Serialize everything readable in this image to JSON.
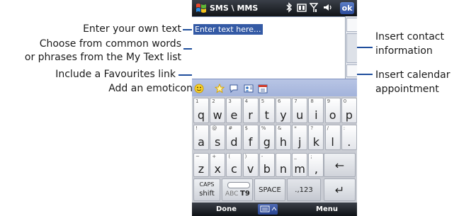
{
  "callouts": {
    "enter_text": "Enter your own text",
    "choose_line1": "Choose from common words",
    "choose_line2": "or phrases from the My Text list",
    "favourites": "Include a Favourites link",
    "emoticon": "Add an emoticon",
    "contact_line1": "Insert contact",
    "contact_line2": "information",
    "calendar_line1": "Insert calendar",
    "calendar_line2": "appointment"
  },
  "phone": {
    "title": "SMS \\ MMS",
    "ok_label": "ok",
    "placeholder": "Enter text here...",
    "softkeys": {
      "left": "Done",
      "right": "Menu"
    },
    "toolbar_icons": [
      "emoticon-icon",
      "favourites-star-icon",
      "my-text-icon",
      "contact-card-icon",
      "calendar-icon"
    ],
    "status_icons": [
      "bluetooth-icon",
      "data-icon",
      "signal-icon",
      "volume-icon"
    ],
    "keyboard": {
      "row1": [
        {
          "sub": "1",
          "main": "q"
        },
        {
          "sub": "2",
          "main": "w"
        },
        {
          "sub": "3",
          "main": "e"
        },
        {
          "sub": "4",
          "main": "r"
        },
        {
          "sub": "5",
          "main": "t"
        },
        {
          "sub": "6",
          "main": "y"
        },
        {
          "sub": "7",
          "main": "u"
        },
        {
          "sub": "8",
          "main": "i"
        },
        {
          "sub": "9",
          "main": "o"
        },
        {
          "sub": "0",
          "main": "p"
        }
      ],
      "row2": [
        {
          "sub": "!",
          "main": "a"
        },
        {
          "sub": "@",
          "main": "s"
        },
        {
          "sub": "#",
          "main": "d"
        },
        {
          "sub": "$",
          "main": "f"
        },
        {
          "sub": "%",
          "main": "g"
        },
        {
          "sub": "&",
          "main": "h"
        },
        {
          "sub": "*",
          "main": "j"
        },
        {
          "sub": "?",
          "main": "k"
        },
        {
          "sub": "/",
          "main": "l"
        },
        {
          "sub": ":",
          "main": "."
        }
      ],
      "row3": [
        {
          "sub": "~",
          "main": "z"
        },
        {
          "sub": "+",
          "main": "x"
        },
        {
          "sub": "(",
          "main": "c"
        },
        {
          "sub": ")",
          "main": "v"
        },
        {
          "sub": "-",
          "main": "b"
        },
        {
          "sub": "",
          "main": "n"
        },
        {
          "sub": "_",
          "main": "m"
        },
        {
          "sub": ";",
          "main": ","
        }
      ],
      "backspace": "←",
      "caps": "CAPS",
      "shift": "shift",
      "abc": "ABC",
      "t9": "T9",
      "space": "SPACE",
      "sym": ".,123",
      "enter": "↵"
    }
  }
}
